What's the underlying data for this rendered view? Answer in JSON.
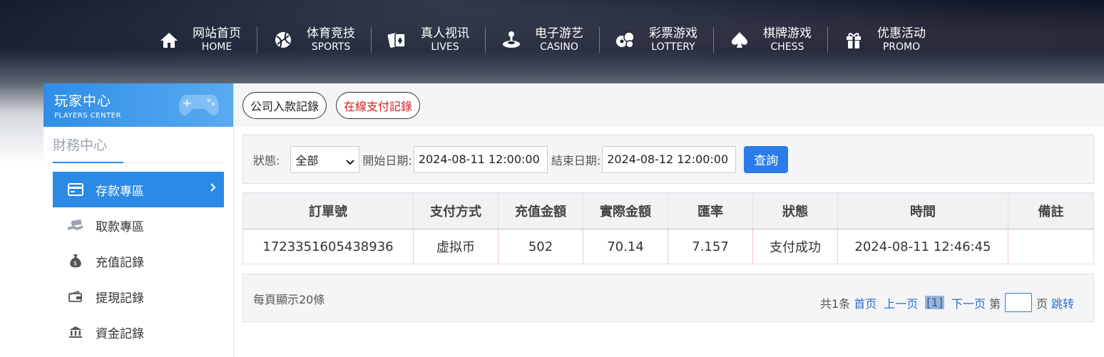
{
  "nav": [
    {
      "cn": "网站首页",
      "en": "HOME",
      "icon": "home-icon"
    },
    {
      "cn": "体育竞技",
      "en": "SPORTS",
      "icon": "ball-icon"
    },
    {
      "cn": "真人视讯",
      "en": "LIVES",
      "icon": "cards-icon"
    },
    {
      "cn": "电子游艺",
      "en": "CASINO",
      "icon": "joystick-icon"
    },
    {
      "cn": "彩票游戏",
      "en": "LOTTERY",
      "icon": "lottery-balls-icon"
    },
    {
      "cn": "棋牌游戏",
      "en": "CHESS",
      "icon": "spade-icon"
    },
    {
      "cn": "优惠活动",
      "en": "PROMO",
      "icon": "gift-icon"
    }
  ],
  "sidebar": {
    "title": "玩家中心",
    "subtitle": "PLAYERS CENTER",
    "section": "財務中心",
    "items": [
      {
        "label": "存款專區",
        "icon": "card-icon",
        "active": true
      },
      {
        "label": "取款專區",
        "icon": "hand-money-icon"
      },
      {
        "label": "充值記錄",
        "icon": "money-bag-icon"
      },
      {
        "label": "提現記錄",
        "icon": "wallet-icon"
      },
      {
        "label": "資金記錄",
        "icon": "bank-icon"
      }
    ]
  },
  "tabs": [
    {
      "label": "公司入款記錄"
    },
    {
      "label": "在線支付記錄"
    }
  ],
  "filter": {
    "status_label": "狀態:",
    "status_value": "全部",
    "start_label": "開始日期:",
    "start_value": "2024-08-11 12:00:00",
    "end_label": "結束日期:",
    "end_value": "2024-08-12 12:00:00",
    "query_button": "查詢"
  },
  "table": {
    "headers": [
      "訂單號",
      "支付方式",
      "充值金額",
      "實際金額",
      "匯率",
      "狀態",
      "時間",
      "備註"
    ],
    "rows": [
      [
        "1723351605438936",
        "虚拟币",
        "502",
        "70.14",
        "7.157",
        "支付成功",
        "2024-08-11 12:46:45",
        ""
      ]
    ]
  },
  "pager": {
    "per_page": "每頁顯示20條",
    "total": "共1条",
    "first": "首页",
    "prev": "上一页",
    "current": "[1]",
    "next": "下一页",
    "page_prefix": "第",
    "page_suffix": "页",
    "jump": "跳转"
  },
  "colors": {
    "accent": "#2b8ae6",
    "button": "#2b7be8",
    "tab_red": "#d21f1f",
    "link": "#2a6fd0"
  }
}
